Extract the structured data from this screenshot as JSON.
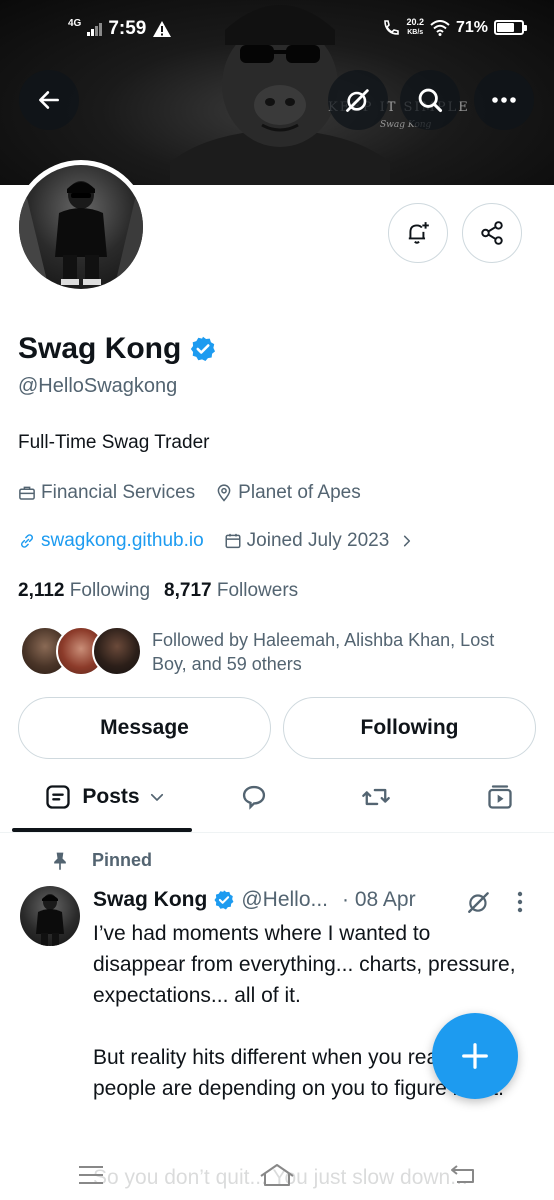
{
  "status_bar": {
    "network": "4G",
    "time": "7:59",
    "speed_value": "20.2",
    "speed_unit": "KB/s",
    "battery": "71%",
    "battery_level": 0.71
  },
  "banner": {
    "tagline": "KEEP IT SIMPLE",
    "signature": "Swag Kong"
  },
  "profile": {
    "display_name": "Swag Kong",
    "handle": "@HelloSwagkong",
    "bio": "Full-Time Swag Trader",
    "category": "Financial Services",
    "location": "Planet of Apes",
    "website": "swagkong.github.io",
    "joined": "Joined July 2023",
    "following_count": "2,112",
    "following_label": "Following",
    "followers_count": "8,717",
    "followers_label": "Followers",
    "followed_by": "Followed by Haleemah, Alishba Khan, Lost Boy, and 59 others"
  },
  "actions": {
    "message_label": "Message",
    "following_label": "Following"
  },
  "tabs": {
    "posts_label": "Posts"
  },
  "post": {
    "pinned_label": "Pinned",
    "author_name": "Swag Kong",
    "author_handle": "@Hello...",
    "date": "· 08 Apr",
    "text": "I’ve had moments where I wanted to disappear from everything... charts, pressure, expectations... all of it.\n\nBut reality hits different when you realize people are depending on you to figure it out.",
    "faded_line": "So you don’t quit... You just slow down..."
  },
  "colors": {
    "accent": "#1d9bf0",
    "text_primary": "#0f1419",
    "text_secondary": "#536471",
    "border": "#cfd9de"
  }
}
